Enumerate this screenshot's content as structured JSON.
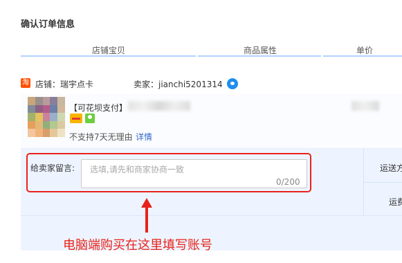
{
  "section_title": "确认订单信息",
  "columns": [
    "店铺宝贝",
    "商品属性",
    "单价"
  ],
  "shop": {
    "icon_text": "淘",
    "label": "店铺：瑞宇点卡",
    "seller": "卖家：jianchi5201314"
  },
  "item": {
    "title": "【可花坝支付】",
    "return_policy": "不支持7天无理由",
    "detail_link": "详情"
  },
  "message": {
    "label": "给卖家留言:",
    "placeholder": "选填,请先和商家协商一致",
    "counter": "0/200"
  },
  "shipping": {
    "label": "运送方",
    "label2": "运费"
  },
  "annotation": "电脑端购买在这里填写账号",
  "colors": {
    "accent": "#e8221a",
    "header_line": "#b2d1ff",
    "panel": "#eef4ff",
    "link": "#3366cc"
  }
}
